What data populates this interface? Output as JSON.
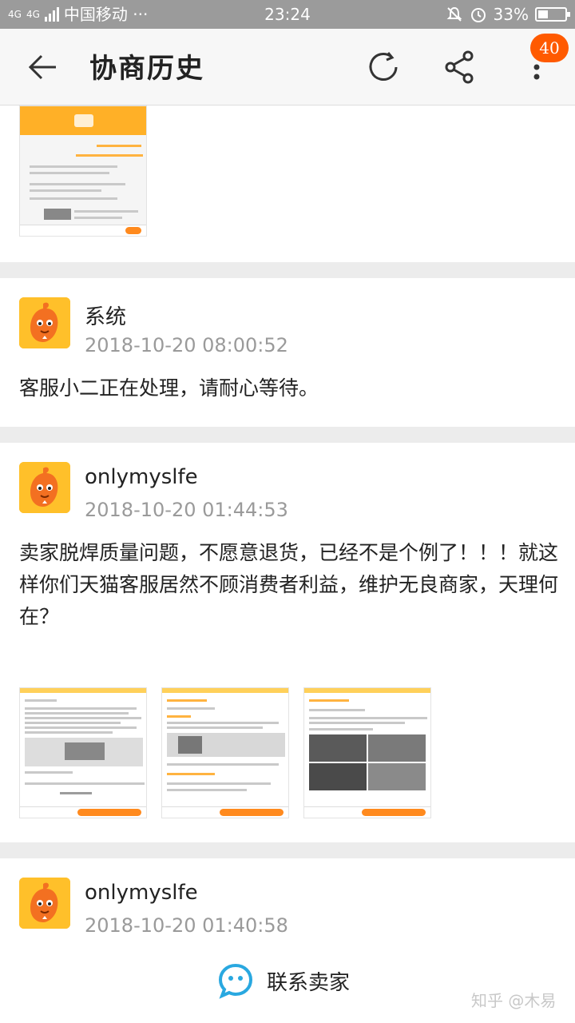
{
  "status_bar": {
    "network_left": "4G",
    "network_right": "4G",
    "carrier": "中国移动 ···",
    "time": "23:24",
    "battery": "33%"
  },
  "header": {
    "back_icon": "arrow-left-icon",
    "title": "协商历史",
    "refresh_icon": "refresh-icon",
    "share_icon": "share-icon",
    "more_icon": "more-vertical-icon",
    "badge_count": "40"
  },
  "entries": [
    {
      "sender": "系统",
      "time": "2018-10-20 08:00:52",
      "message": "客服小二正在处理，请耐心等待。"
    },
    {
      "sender": "onlymyslfe",
      "time": "2018-10-20 01:44:53",
      "message": "卖家脱焊质量问题，不愿意退货，已经不是个例了！！！就这样你们天猫客服居然不顾消费者利益，维护无良商家，天理何在？"
    },
    {
      "sender": "onlymyslfe",
      "time": "2018-10-20 01:40:58"
    }
  ],
  "footer": {
    "contact_label": "联系卖家",
    "contact_icon": "chat-bubble-icon"
  },
  "watermark": "知乎 @木易",
  "colors": {
    "accent": "#ff5a00",
    "avatar_bg": "#ffb81e",
    "status_bar": "#9b9b9b",
    "contact_icon": "#29a8e0"
  }
}
